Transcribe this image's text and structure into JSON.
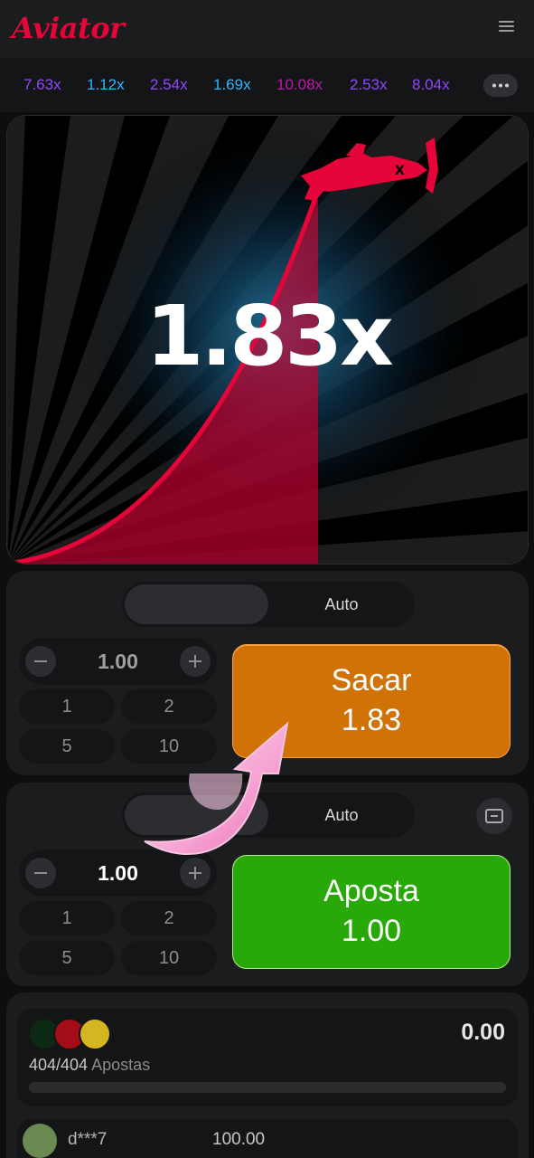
{
  "header": {
    "logo_text": "Aviator",
    "menu_icon": "hamburger-icon"
  },
  "history": {
    "items": [
      {
        "value": "7.63x",
        "color": "#9146ff"
      },
      {
        "value": "1.12x",
        "color": "#34b4ff"
      },
      {
        "value": "2.54x",
        "color": "#9146ff"
      },
      {
        "value": "1.69x",
        "color": "#34b4ff"
      },
      {
        "value": "10.08x",
        "color": "#c017b4"
      },
      {
        "value": "2.53x",
        "color": "#9146ff"
      },
      {
        "value": "8.04x",
        "color": "#9146ff"
      }
    ],
    "more_icon": "ellipsis-icon"
  },
  "game": {
    "multiplier": "1.83x",
    "accent": "#e50539"
  },
  "panel1": {
    "tab_auto": "Auto",
    "amount": "1.00",
    "chips": [
      "1",
      "2",
      "5",
      "10"
    ],
    "action_label": "Sacar",
    "action_value": "1.83",
    "action_color": "#d07206"
  },
  "panel2": {
    "tab_auto": "Auto",
    "amount": "1.00",
    "chips": [
      "1",
      "2",
      "5",
      "10"
    ],
    "action_label": "Aposta",
    "action_value": "1.00",
    "action_color": "#28a909"
  },
  "bets": {
    "total": "0.00",
    "count": "404/404",
    "count_label": "Apostas",
    "progress": 0,
    "rows": [
      {
        "user": "d***7",
        "amount": "100.00"
      }
    ]
  }
}
